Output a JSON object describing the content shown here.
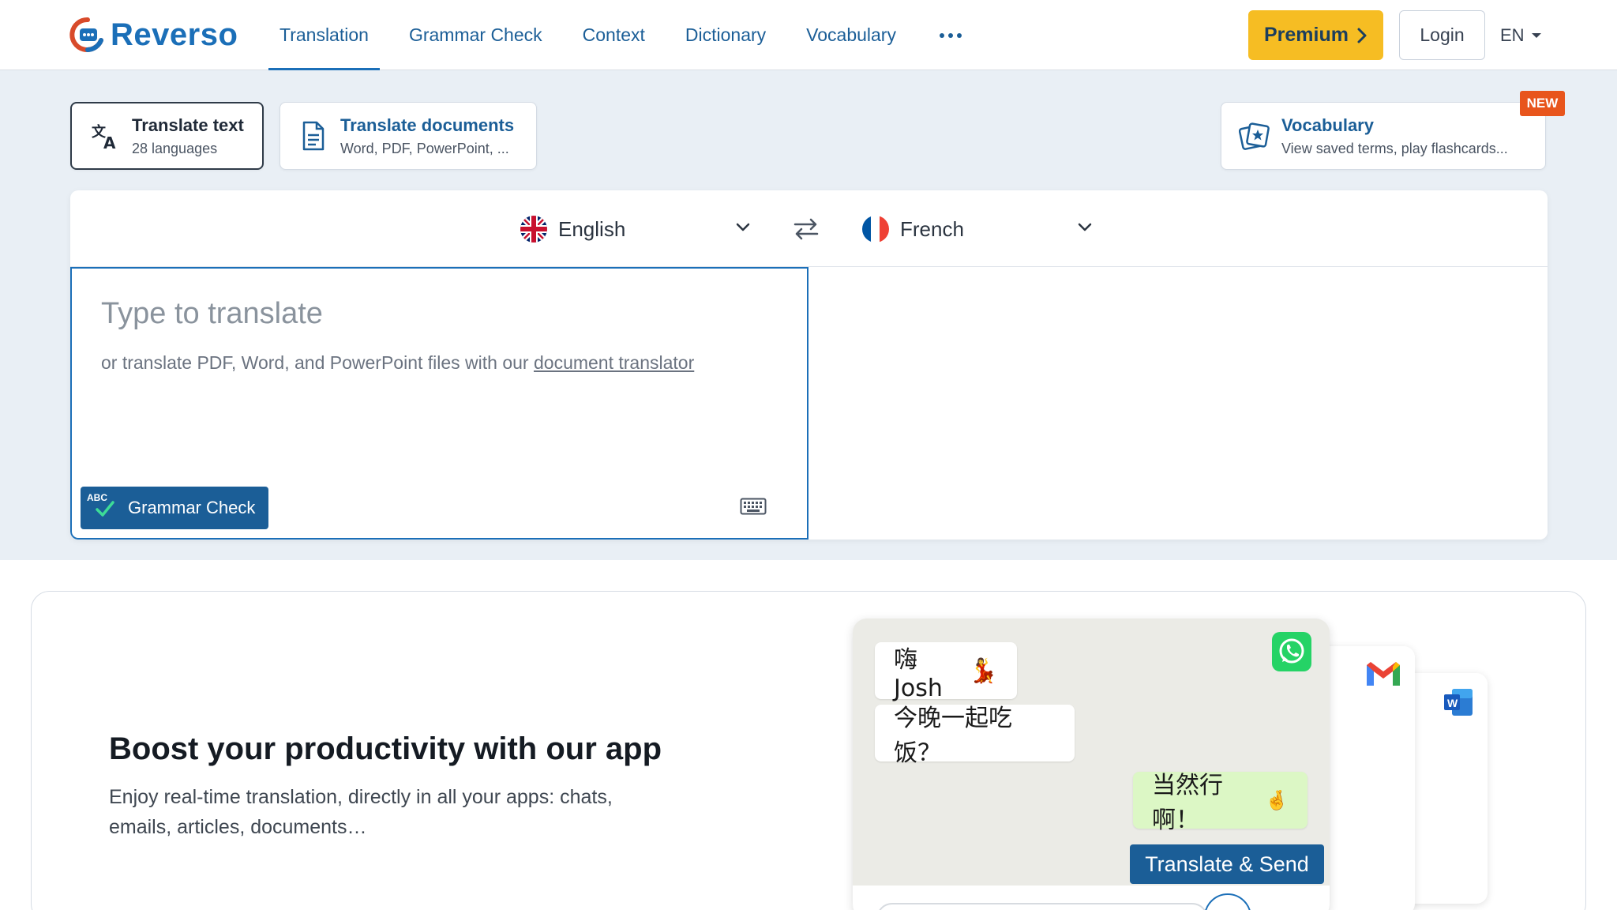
{
  "header": {
    "logo_text": "Reverso",
    "nav": [
      {
        "label": "Translation",
        "active": true
      },
      {
        "label": "Grammar Check"
      },
      {
        "label": "Context"
      },
      {
        "label": "Dictionary"
      },
      {
        "label": "Vocabulary"
      }
    ],
    "more_icon": "ellipsis-icon",
    "premium_label": "Premium",
    "login_label": "Login",
    "lang_label": "EN",
    "colors": {
      "brand": "#1b6fb8",
      "premium": "#f6bd23"
    }
  },
  "modes": {
    "text": {
      "title": "Translate text",
      "subtitle": "28 languages",
      "icon": "translate-icon"
    },
    "docs": {
      "title": "Translate documents",
      "subtitle": "Word, PDF, PowerPoint, ...",
      "icon": "document-icon"
    },
    "vocab": {
      "title": "Vocabulary",
      "subtitle": "View saved terms, play flashcards...",
      "badge": "NEW",
      "icon": "flashcards-icon"
    }
  },
  "translator": {
    "source_lang": "English",
    "target_lang": "French",
    "placeholder": "Type to translate",
    "doc_hint_prefix": "or translate PDF, Word, and PowerPoint files with our",
    "doc_hint_link": "document translator",
    "grammar_btn_abc": "ABC",
    "grammar_btn": "Grammar Check",
    "keyboard_icon": "keyboard-icon",
    "swap_icon": "swap-icon"
  },
  "promo": {
    "title": "Boost your productivity with our app",
    "subtitle": "Enjoy real-time translation, directly in all your apps: chats, emails, articles, documents…",
    "chat": {
      "msg1": "嗨Josh",
      "msg2": "今晚一起吃饭？",
      "msg3": "当然行啊！",
      "action": "Translate & Send"
    }
  }
}
